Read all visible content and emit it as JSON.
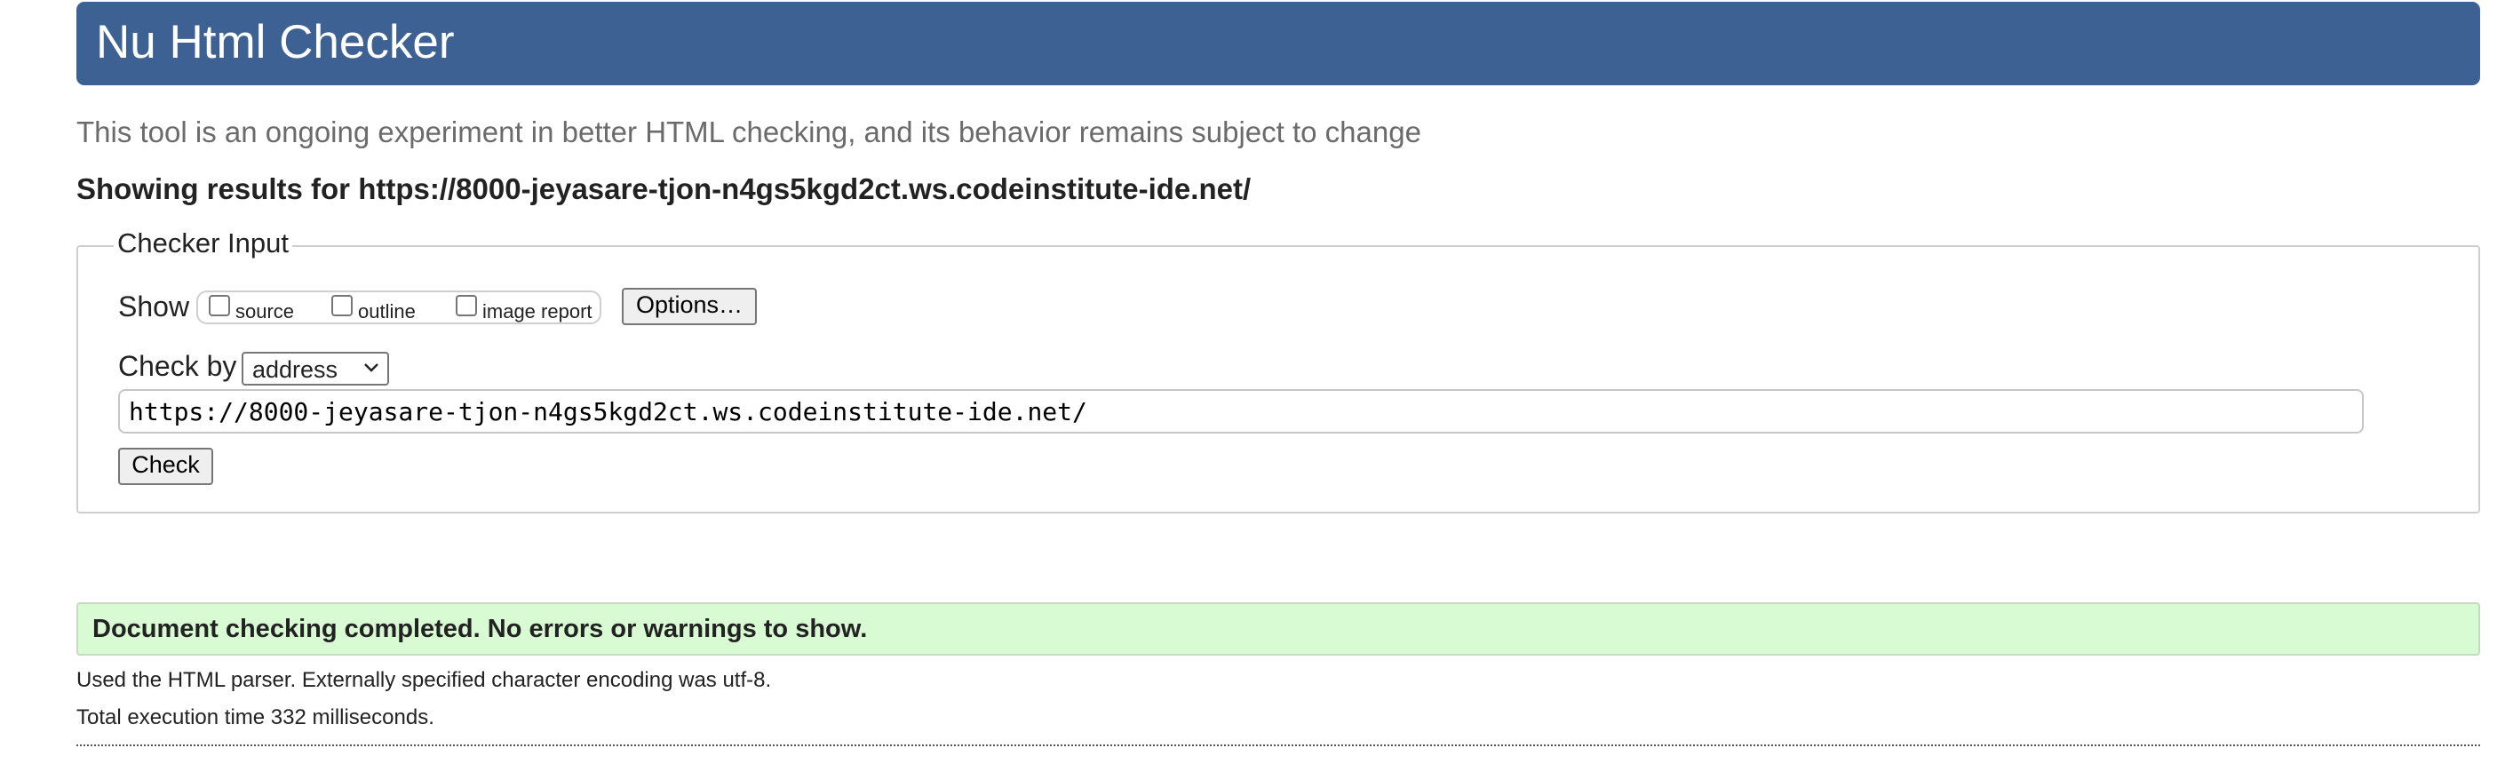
{
  "header": {
    "title": "Nu Html Checker"
  },
  "tagline": "This tool is an ongoing experiment in better HTML checking, and its behavior remains subject to change",
  "results": {
    "prefix": "Showing results for",
    "url": "https://8000-jeyasare-tjon-n4gs5kgd2ct.ws.codeinstitute-ide.net/"
  },
  "checker_input": {
    "legend": "Checker Input",
    "show_label": "Show",
    "show_options": [
      {
        "label": "source",
        "checked": false
      },
      {
        "label": "outline",
        "checked": false
      },
      {
        "label": "image report",
        "checked": false
      }
    ],
    "options_button": "Options…",
    "check_by_label": "Check by",
    "check_by_value": "address",
    "url_value": "https://8000-jeyasare-tjon-n4gs5kgd2ct.ws.codeinstitute-ide.net/",
    "check_button": "Check"
  },
  "status": {
    "message": "Document checking completed. No errors or warnings to show.",
    "color": "#d9fbd3"
  },
  "info": {
    "parser": "Used the HTML parser. Externally specified character encoding was utf-8.",
    "time": "Total execution time 332 milliseconds."
  },
  "colors": {
    "header_bg": "#3e6194"
  },
  "icons": {
    "select_arrow": "chevron-down-icon"
  }
}
